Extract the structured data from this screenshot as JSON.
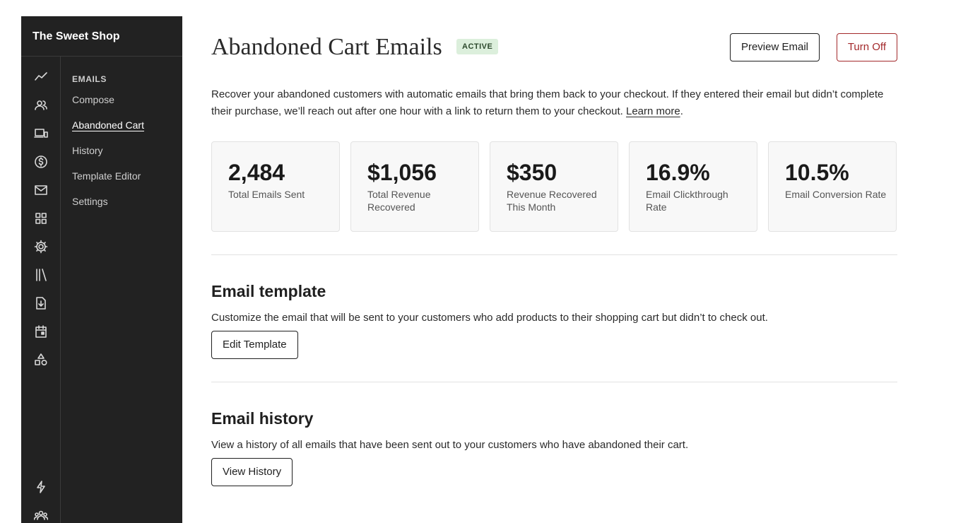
{
  "sidebar": {
    "shop_name": "The Sweet Shop",
    "rail_icons": [
      "analytics-icon",
      "customers-icon",
      "devices-icon",
      "dollar-icon",
      "mail-icon",
      "apps-grid-icon",
      "gear-icon",
      "library-icon",
      "file-download-icon",
      "calendar-icon",
      "shapes-icon",
      "lightning-icon",
      "team-icon"
    ],
    "subnav_heading": "EMAILS",
    "items": [
      {
        "label": "Compose",
        "active": false
      },
      {
        "label": "Abandoned Cart",
        "active": true
      },
      {
        "label": "History",
        "active": false
      },
      {
        "label": "Template Editor",
        "active": false
      },
      {
        "label": "Settings",
        "active": false
      }
    ]
  },
  "header": {
    "title": "Abandoned Cart Emails",
    "status_badge": "ACTIVE",
    "preview_button": "Preview Email",
    "turn_off_button": "Turn Off"
  },
  "intro": {
    "text": "Recover your abandoned customers with automatic emails that bring them back to your checkout. If they entered their email but didn’t complete their purchase, we’ll reach out after one hour with a link to return them to your checkout. ",
    "link": "Learn more",
    "trailing": "."
  },
  "stats": [
    {
      "value": "2,484",
      "label": "Total Emails Sent"
    },
    {
      "value": "$1,056",
      "label": "Total Revenue Recovered"
    },
    {
      "value": "$350",
      "label": "Revenue Recovered This Month"
    },
    {
      "value": "16.9%",
      "label": "Email Clickthrough Rate"
    },
    {
      "value": "10.5%",
      "label": "Email Conversion Rate"
    }
  ],
  "template_section": {
    "title": "Email template",
    "description": "Customize the email that will be sent to your customers who add products to their shopping cart but didn’t to check out.",
    "button": "Edit Template"
  },
  "history_section": {
    "title": "Email history",
    "description": "View a history of all emails that have been sent out to your customers who have abandoned their cart.",
    "button": "View History"
  },
  "colors": {
    "sidebar_bg": "#222222",
    "accent_danger": "#a3292b",
    "badge_bg": "#dcefdc"
  }
}
